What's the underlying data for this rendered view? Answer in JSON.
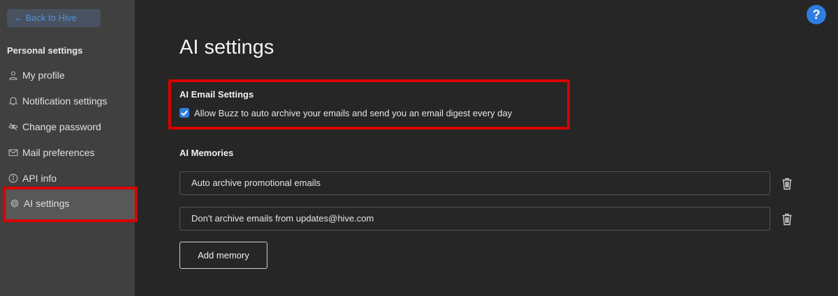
{
  "sidebar": {
    "back_label": "← Back to Hive",
    "section_title": "Personal settings",
    "items": [
      {
        "label": "My profile",
        "icon": "person-icon"
      },
      {
        "label": "Notification settings",
        "icon": "bell-icon"
      },
      {
        "label": "Change password",
        "icon": "eye-off-icon"
      },
      {
        "label": "Mail preferences",
        "icon": "mail-icon"
      },
      {
        "label": "API info",
        "icon": "info-icon"
      },
      {
        "label": "AI settings",
        "icon": "gear-icon",
        "active": true
      }
    ]
  },
  "header": {
    "help_label": "?"
  },
  "main": {
    "title": "AI settings",
    "email_settings": {
      "heading": "AI Email Settings",
      "checkbox_label": "Allow Buzz to auto archive your emails and send you an email digest every day",
      "checked": true
    },
    "memories": {
      "heading": "AI Memories",
      "items": [
        "Auto archive promotional emails",
        "Don't archive emails from updates@hive.com"
      ],
      "add_label": "Add memory"
    }
  },
  "colors": {
    "accent": "#2f7de0",
    "highlight": "#d80000",
    "sidebar_bg": "#404040",
    "main_bg": "#262626"
  }
}
